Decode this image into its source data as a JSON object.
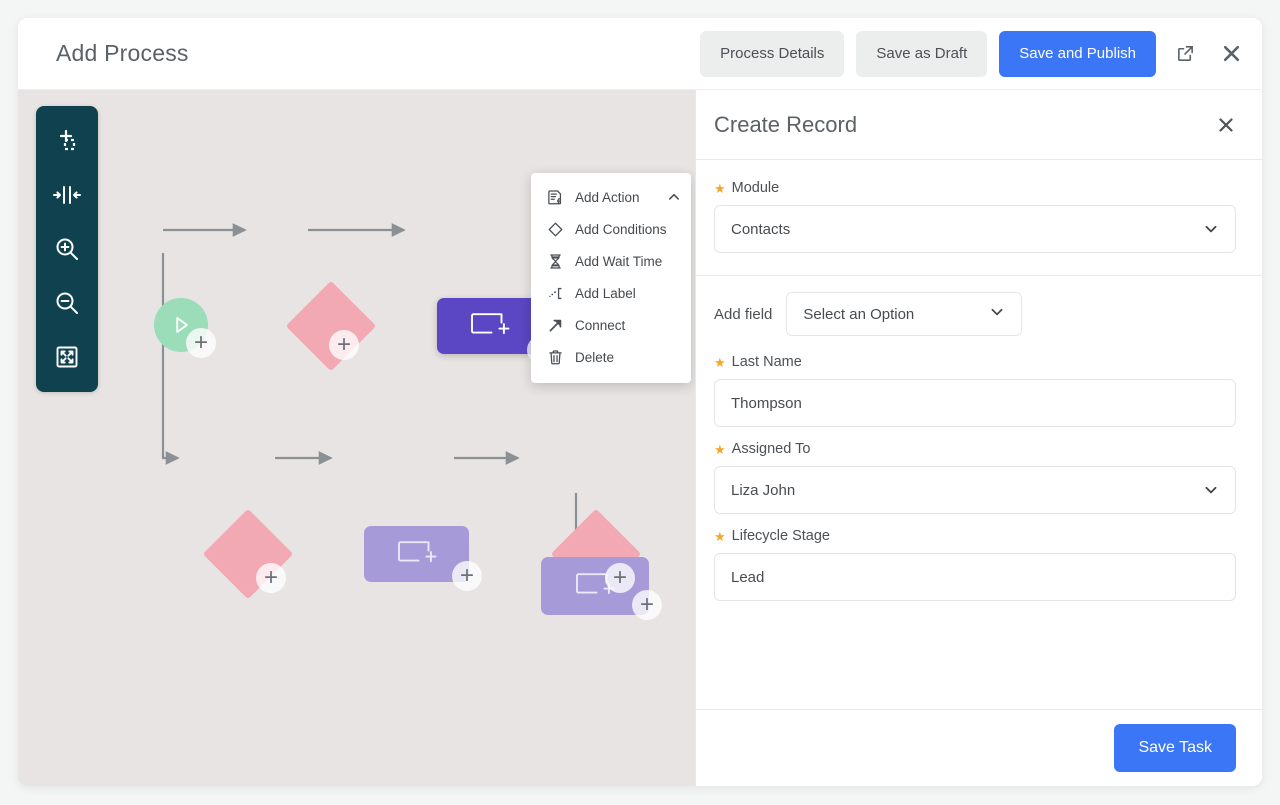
{
  "header": {
    "title": "Add Process",
    "buttons": [
      {
        "label": "Process Details",
        "style": "secondary"
      },
      {
        "label": "Save as Draft",
        "style": "secondary"
      },
      {
        "label": "Save and Publish",
        "style": "primary"
      }
    ],
    "icons": [
      {
        "name": "external-link-icon"
      },
      {
        "name": "close-icon"
      }
    ]
  },
  "canvas": {
    "toolbar": {
      "items": [
        {
          "name": "add-node-icon",
          "title": "Add Node"
        },
        {
          "name": "auto-align-icon",
          "title": "Auto Align"
        },
        {
          "name": "zoom-in-icon",
          "title": "Zoom In"
        },
        {
          "name": "zoom-out-icon",
          "title": "Zoom Out"
        },
        {
          "name": "fit-to-screen-icon",
          "title": "Fit to Screen"
        }
      ]
    },
    "nodes": [
      {
        "id": "start",
        "type": "start",
        "icon": "play-icon"
      },
      {
        "id": "cond-1",
        "type": "condition",
        "icon": "branch-icon"
      },
      {
        "id": "action-1",
        "type": "action",
        "icon": "create-record-icon",
        "selected": true
      },
      {
        "id": "cond-2",
        "type": "condition",
        "icon": "branch-icon"
      },
      {
        "id": "action-2",
        "type": "action",
        "icon": "create-record-icon",
        "selected": false
      },
      {
        "id": "cond-3",
        "type": "condition",
        "icon": "branch-icon"
      },
      {
        "id": "action-3",
        "type": "action",
        "icon": "create-record-icon",
        "selected": false
      }
    ],
    "context_menu": {
      "items": [
        {
          "label": "Add Action",
          "icon": "action-document-icon",
          "expanded": true
        },
        {
          "label": "Add Conditions",
          "icon": "diamond-icon"
        },
        {
          "label": "Add Wait Time",
          "icon": "hourglass-icon"
        },
        {
          "label": "Add Label",
          "icon": "label-bracket-icon"
        },
        {
          "label": "Connect",
          "icon": "arrow-up-right-icon"
        },
        {
          "label": "Delete",
          "icon": "trash-icon"
        }
      ],
      "chevron": "chevron-up-icon"
    }
  },
  "panel": {
    "title": "Create Record",
    "close_icon": "close-icon",
    "module": {
      "label": "Module",
      "required": true,
      "value": "Contacts",
      "chevron": "chevron-down-icon"
    },
    "add_field": {
      "label": "Add field",
      "value": "Select an Option",
      "chevron": "chevron-down-icon"
    },
    "fields": [
      {
        "label": "Last Name",
        "required": true,
        "value": "Thompson",
        "type": "text"
      },
      {
        "label": "Assigned To",
        "required": true,
        "value": "Liza John",
        "type": "select"
      },
      {
        "label": "Lifecycle Stage",
        "required": true,
        "value": "Lead",
        "type": "text"
      }
    ],
    "footer": {
      "save_label": "Save Task"
    }
  },
  "colors": {
    "primary": "#3b76f6",
    "toolbar_bg": "#10414f",
    "canvas_bg": "#e8e4e3",
    "node_selected": "#5b47c4",
    "node_plain": "#a79ad9",
    "condition": "#f3a9b4",
    "start": "#9bdcb9",
    "required_star": "#f6a623"
  }
}
